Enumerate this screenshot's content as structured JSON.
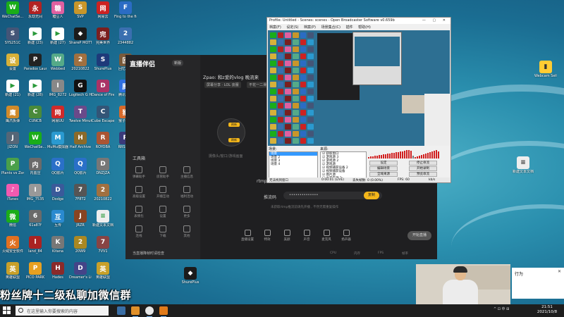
{
  "desktop": {
    "banner_text": "粉丝牌十二级私聊加微信群",
    "icons": [
      {
        "label": "WeChatSe...",
        "color": "#1aad19",
        "glyph": "W"
      },
      {
        "label": "永劫无间",
        "color": "#b22222",
        "glyph": "永"
      },
      {
        "label": "糖豆人",
        "color": "#e060a0",
        "glyph": "糖"
      },
      {
        "label": "SVP",
        "color": "#c8962a",
        "glyph": "S"
      },
      {
        "label": "网易云",
        "color": "#cc2222",
        "glyph": "网"
      },
      {
        "label": "Fing to the finish",
        "color": "#2b6cc4",
        "glyph": "F"
      },
      {
        "label": "SYS251C",
        "color": "#445577",
        "glyph": "S"
      },
      {
        "label": "新建 (23)",
        "color": "#ffffff",
        "glyph": "▶"
      },
      {
        "label": "新建 (27)",
        "color": "#ffffff",
        "glyph": "▶"
      },
      {
        "label": "ShareP MOTTV",
        "color": "#1b1b1b",
        "glyph": "◆"
      },
      {
        "label": "完美世界",
        "color": "#7a1f1f",
        "glyph": "完"
      },
      {
        "label": "2344882",
        "color": "#3a6fb0",
        "glyph": "2"
      },
      {
        "label": "设置",
        "color": "#d6b13a",
        "glyph": "设"
      },
      {
        "label": "Paradox Launcher",
        "color": "#222222",
        "glyph": "P"
      },
      {
        "label": "Webbed",
        "color": "#55aa88",
        "glyph": "W"
      },
      {
        "label": "20210822",
        "color": "#a07040",
        "glyph": "2"
      },
      {
        "label": "ShurePlus",
        "color": "#1e3a7a",
        "glyph": "S"
      },
      {
        "label": "回忆小镇",
        "color": "#7a5a3a",
        "glyph": "回"
      },
      {
        "label": "新建 (21)",
        "color": "#ffffff",
        "glyph": "▶"
      },
      {
        "label": "新建 (28)",
        "color": "#ffffff",
        "glyph": "▶"
      },
      {
        "label": "IMG_8272",
        "color": "#888888",
        "glyph": "I"
      },
      {
        "label": "Logitech G HUB",
        "color": "#111111",
        "glyph": "G"
      },
      {
        "label": "Dance of Fire",
        "color": "#aa3366",
        "glyph": "D"
      },
      {
        "label": "腾讯会议",
        "color": "#2f6fe0",
        "glyph": "腾"
      },
      {
        "label": "鹰爪拆弹",
        "color": "#d08a2a",
        "glyph": "鹰"
      },
      {
        "label": "CUNCB",
        "color": "#4a8a3a",
        "glyph": "C"
      },
      {
        "label": "网易UU",
        "color": "#d02a2a",
        "glyph": "网"
      },
      {
        "label": "Twelve Minutes",
        "color": "#6a4a8a",
        "glyph": "T"
      },
      {
        "label": "Cube Escape",
        "color": "#335577",
        "glyph": "C"
      },
      {
        "label": "猴子出气",
        "color": "#d86a2a",
        "glyph": "猴"
      },
      {
        "label": "JIZON",
        "color": "#556677",
        "glyph": "J"
      },
      {
        "label": "WeChatSe...",
        "color": "#1aad19",
        "glyph": "W"
      },
      {
        "label": "MuMu模拟器",
        "color": "#2a9ad0",
        "glyph": "M"
      },
      {
        "label": "Half Archive",
        "color": "#8a6a2a",
        "glyph": "H"
      },
      {
        "label": "ROYOBA",
        "color": "#aa5533",
        "glyph": "R"
      },
      {
        "label": "RRSXGA",
        "color": "#3a3a7a",
        "glyph": "R"
      },
      {
        "label": "Plants vs Zombies",
        "color": "#4aa04a",
        "glyph": "P"
      },
      {
        "label": "内置应",
        "color": "#6a6a6a",
        "glyph": "内"
      },
      {
        "label": "QQ影片",
        "color": "#2a70c8",
        "glyph": "Q"
      },
      {
        "label": "QQ影片",
        "color": "#2a70c8",
        "glyph": "Q"
      },
      {
        "label": "DNZJZA",
        "color": "#777777",
        "glyph": "D"
      },
      {
        "label": "b4eF",
        "color": "#994444",
        "glyph": "b"
      },
      {
        "label": "iTunes",
        "color": "#f25ab0",
        "glyph": "♪"
      },
      {
        "label": "IMG_7535",
        "color": "#999999",
        "glyph": "I"
      },
      {
        "label": "Dodge",
        "color": "#3a5a9a",
        "glyph": "D"
      },
      {
        "label": "7F8T2",
        "color": "#555555",
        "glyph": "7"
      },
      {
        "label": "20210822",
        "color": "#a07040",
        "glyph": "2"
      },
      {
        "label": "Barotrauma",
        "color": "#335566",
        "glyph": "B"
      },
      {
        "label": "微信",
        "color": "#1aad19",
        "glyph": "微"
      },
      {
        "label": "61a87f",
        "color": "#6a6a6a",
        "glyph": "6"
      },
      {
        "label": "互传",
        "color": "#2a8ad0",
        "glyph": "互"
      },
      {
        "label": "JRZR",
        "color": "#884422",
        "glyph": "J"
      },
      {
        "label": "新建文本文档",
        "color": "#eeeeee",
        "glyph": "≡"
      },
      {
        "label": "Tabletop Sim",
        "color": "#3a7aa0",
        "glyph": "T"
      },
      {
        "label": "火绒安全软件",
        "color": "#e07020",
        "glyph": "火"
      },
      {
        "label": "land_84",
        "color": "#aa2222",
        "glyph": "l"
      },
      {
        "label": "Kitana",
        "color": "#777777",
        "glyph": "K"
      },
      {
        "label": "20W9",
        "color": "#aa8822",
        "glyph": "2"
      },
      {
        "label": "7VV1",
        "color": "#884444",
        "glyph": "7"
      },
      {
        "label": "Red Mi Studio",
        "color": "#bb2222",
        "glyph": "R"
      },
      {
        "label": "英雄联盟",
        "color": "#c8a02a",
        "glyph": "英"
      },
      {
        "label": "PICO PARK",
        "color": "#e8a020",
        "glyph": "P"
      },
      {
        "label": "Hades",
        "color": "#8a2a2a",
        "glyph": "H"
      },
      {
        "label": "Dreamer's Life",
        "color": "#444488",
        "glyph": "D"
      },
      {
        "label": "英雄联盟",
        "color": "#c8a02a",
        "glyph": "英"
      },
      {
        "label": "Ad338",
        "color": "#aa3333",
        "glyph": "A"
      },
      {
        "label": "ShurePlus",
        "color": "#1b1b1b",
        "glyph": "◆"
      }
    ],
    "right_icons": [
      {
        "label": "Webcam Settings",
        "color": "#ffcc33",
        "glyph": "▮"
      },
      {
        "label": "新建文本文档",
        "color": "#eeeeee",
        "glyph": "≡"
      }
    ]
  },
  "live_app": {
    "brand": "直播伴侣",
    "version": "新版",
    "title": "Zpao: 和z爱的vlog  晚流来",
    "tags": [
      "屏幕分享 · LOL 丧服",
      "不花一二滑"
    ],
    "hint": "摄像头/窗口/游戏画面",
    "cam_btn1": "刷新",
    "cam_btn2": "刷新",
    "rtmp_label": "rtmp",
    "push_label": "推流码",
    "push_value": "••••••••••••••",
    "copy_btn": "复制",
    "note": "未获取rtmp推流前请先开播 , 不然无需重复操作",
    "toolbox_label": "工具箱",
    "left_tools": [
      "弹幕助手",
      "房管助手",
      "主播信息",
      "高级设置",
      "开播互动",
      "福利活动",
      "表情包",
      "设置",
      "更多",
      "连线",
      "下载",
      "其他"
    ],
    "bottom_tools": [
      "直播设置",
      "特效",
      "美颜",
      "声音",
      "麦克风",
      "扬声器"
    ],
    "start_btn": "开始直播",
    "stats": [
      "CPU",
      "内存",
      "FPS",
      "帧率"
    ],
    "notice": "当直播降帧时请检查"
  },
  "obs": {
    "title": "Profile: Untitled - Scenes: scenes - Open Broadcaster Software v0.659b",
    "menu": [
      "档案(F)",
      "设定(S)",
      "档案(P)",
      "场景集合(C)",
      "插件",
      "帮助(H)"
    ],
    "scenes_label": "场景:",
    "scenes": [
      "场景",
      "场景 2",
      "场景 3",
      "场景 4"
    ],
    "sources_label": "来源:",
    "sources": [
      "获取窗口",
      "游戏源 3",
      "游戏源 2",
      "游戏源",
      "视频捕获设备 2",
      "视频捕获设备",
      "图片源",
      "文字来源 2"
    ],
    "buttons": [
      "设定",
      "编辑场景",
      "全域来源",
      "插件",
      "停止串流",
      "开始录制",
      "预览串流",
      "退出"
    ],
    "status": [
      "无法找到窗口",
      "0:00:01 (LIVE)",
      "丢失帧数: 0 (0.00%)",
      "FPS: 60",
      "kb/s"
    ]
  },
  "notification": {
    "text": "行为"
  },
  "taskbar": {
    "search_placeholder": "在这里输入你要搜索的内容",
    "tray": "^ ⊡ 中 ⊞",
    "time": "21:51",
    "date": "2021/10/8"
  }
}
